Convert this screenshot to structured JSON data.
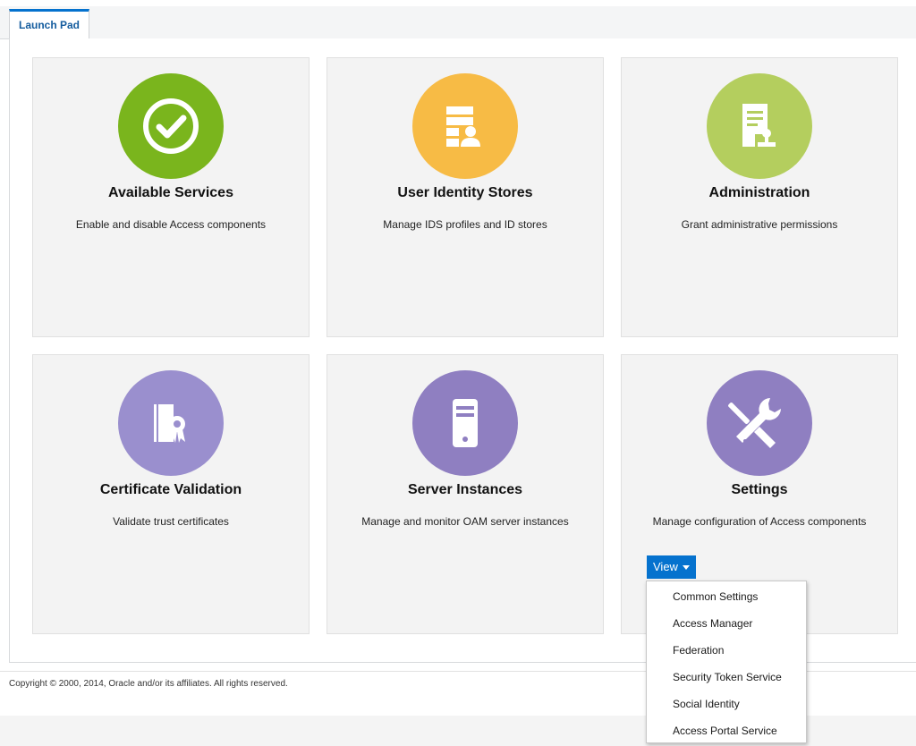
{
  "tabs": [
    {
      "label": "Launch Pad",
      "active": true
    }
  ],
  "colors": {
    "accent": "#0572ce",
    "available_services_circle": "#7ab51d",
    "user_identity_circle": "#f7bb45",
    "administration_circle": "#b4ce5e",
    "certificate_circle": "#9a8fce",
    "server_circle": "#8f7fc1",
    "settings_circle": "#8f7fc1"
  },
  "cards": [
    {
      "title": "Available Services",
      "description": "Enable and disable Access components",
      "icon": "check-circle-icon"
    },
    {
      "title": "User Identity Stores",
      "description": "Manage IDS profiles and ID stores",
      "icon": "identity-store-icon"
    },
    {
      "title": "Administration",
      "description": "Grant administrative permissions",
      "icon": "document-stamp-icon"
    },
    {
      "title": "Certificate Validation",
      "description": "Validate trust certificates",
      "icon": "certificate-icon"
    },
    {
      "title": "Server Instances",
      "description": "Manage and monitor OAM server instances",
      "icon": "server-icon"
    },
    {
      "title": "Settings",
      "description": "Manage configuration of Access components",
      "icon": "tools-icon"
    }
  ],
  "settings_menu": {
    "button_label": "View",
    "items": [
      "Common Settings",
      "Access Manager",
      "Federation",
      "Security Token Service",
      "Social Identity",
      "Access Portal Service"
    ]
  },
  "footer": {
    "copyright": "Copyright © 2000, 2014, Oracle and/or its affiliates. All rights reserved."
  }
}
